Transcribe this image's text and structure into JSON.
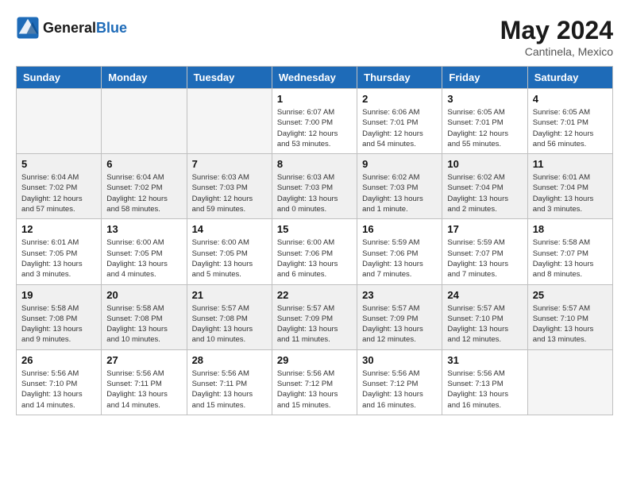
{
  "logo": {
    "text_general": "General",
    "text_blue": "Blue"
  },
  "title": {
    "month_year": "May 2024",
    "location": "Cantinela, Mexico"
  },
  "headers": [
    "Sunday",
    "Monday",
    "Tuesday",
    "Wednesday",
    "Thursday",
    "Friday",
    "Saturday"
  ],
  "weeks": [
    [
      {
        "day": "",
        "info": ""
      },
      {
        "day": "",
        "info": ""
      },
      {
        "day": "",
        "info": ""
      },
      {
        "day": "1",
        "info": "Sunrise: 6:07 AM\nSunset: 7:00 PM\nDaylight: 12 hours\nand 53 minutes."
      },
      {
        "day": "2",
        "info": "Sunrise: 6:06 AM\nSunset: 7:01 PM\nDaylight: 12 hours\nand 54 minutes."
      },
      {
        "day": "3",
        "info": "Sunrise: 6:05 AM\nSunset: 7:01 PM\nDaylight: 12 hours\nand 55 minutes."
      },
      {
        "day": "4",
        "info": "Sunrise: 6:05 AM\nSunset: 7:01 PM\nDaylight: 12 hours\nand 56 minutes."
      }
    ],
    [
      {
        "day": "5",
        "info": "Sunrise: 6:04 AM\nSunset: 7:02 PM\nDaylight: 12 hours\nand 57 minutes."
      },
      {
        "day": "6",
        "info": "Sunrise: 6:04 AM\nSunset: 7:02 PM\nDaylight: 12 hours\nand 58 minutes."
      },
      {
        "day": "7",
        "info": "Sunrise: 6:03 AM\nSunset: 7:03 PM\nDaylight: 12 hours\nand 59 minutes."
      },
      {
        "day": "8",
        "info": "Sunrise: 6:03 AM\nSunset: 7:03 PM\nDaylight: 13 hours\nand 0 minutes."
      },
      {
        "day": "9",
        "info": "Sunrise: 6:02 AM\nSunset: 7:03 PM\nDaylight: 13 hours\nand 1 minute."
      },
      {
        "day": "10",
        "info": "Sunrise: 6:02 AM\nSunset: 7:04 PM\nDaylight: 13 hours\nand 2 minutes."
      },
      {
        "day": "11",
        "info": "Sunrise: 6:01 AM\nSunset: 7:04 PM\nDaylight: 13 hours\nand 3 minutes."
      }
    ],
    [
      {
        "day": "12",
        "info": "Sunrise: 6:01 AM\nSunset: 7:05 PM\nDaylight: 13 hours\nand 3 minutes."
      },
      {
        "day": "13",
        "info": "Sunrise: 6:00 AM\nSunset: 7:05 PM\nDaylight: 13 hours\nand 4 minutes."
      },
      {
        "day": "14",
        "info": "Sunrise: 6:00 AM\nSunset: 7:05 PM\nDaylight: 13 hours\nand 5 minutes."
      },
      {
        "day": "15",
        "info": "Sunrise: 6:00 AM\nSunset: 7:06 PM\nDaylight: 13 hours\nand 6 minutes."
      },
      {
        "day": "16",
        "info": "Sunrise: 5:59 AM\nSunset: 7:06 PM\nDaylight: 13 hours\nand 7 minutes."
      },
      {
        "day": "17",
        "info": "Sunrise: 5:59 AM\nSunset: 7:07 PM\nDaylight: 13 hours\nand 7 minutes."
      },
      {
        "day": "18",
        "info": "Sunrise: 5:58 AM\nSunset: 7:07 PM\nDaylight: 13 hours\nand 8 minutes."
      }
    ],
    [
      {
        "day": "19",
        "info": "Sunrise: 5:58 AM\nSunset: 7:08 PM\nDaylight: 13 hours\nand 9 minutes."
      },
      {
        "day": "20",
        "info": "Sunrise: 5:58 AM\nSunset: 7:08 PM\nDaylight: 13 hours\nand 10 minutes."
      },
      {
        "day": "21",
        "info": "Sunrise: 5:57 AM\nSunset: 7:08 PM\nDaylight: 13 hours\nand 10 minutes."
      },
      {
        "day": "22",
        "info": "Sunrise: 5:57 AM\nSunset: 7:09 PM\nDaylight: 13 hours\nand 11 minutes."
      },
      {
        "day": "23",
        "info": "Sunrise: 5:57 AM\nSunset: 7:09 PM\nDaylight: 13 hours\nand 12 minutes."
      },
      {
        "day": "24",
        "info": "Sunrise: 5:57 AM\nSunset: 7:10 PM\nDaylight: 13 hours\nand 12 minutes."
      },
      {
        "day": "25",
        "info": "Sunrise: 5:57 AM\nSunset: 7:10 PM\nDaylight: 13 hours\nand 13 minutes."
      }
    ],
    [
      {
        "day": "26",
        "info": "Sunrise: 5:56 AM\nSunset: 7:10 PM\nDaylight: 13 hours\nand 14 minutes."
      },
      {
        "day": "27",
        "info": "Sunrise: 5:56 AM\nSunset: 7:11 PM\nDaylight: 13 hours\nand 14 minutes."
      },
      {
        "day": "28",
        "info": "Sunrise: 5:56 AM\nSunset: 7:11 PM\nDaylight: 13 hours\nand 15 minutes."
      },
      {
        "day": "29",
        "info": "Sunrise: 5:56 AM\nSunset: 7:12 PM\nDaylight: 13 hours\nand 15 minutes."
      },
      {
        "day": "30",
        "info": "Sunrise: 5:56 AM\nSunset: 7:12 PM\nDaylight: 13 hours\nand 16 minutes."
      },
      {
        "day": "31",
        "info": "Sunrise: 5:56 AM\nSunset: 7:13 PM\nDaylight: 13 hours\nand 16 minutes."
      },
      {
        "day": "",
        "info": ""
      }
    ]
  ]
}
